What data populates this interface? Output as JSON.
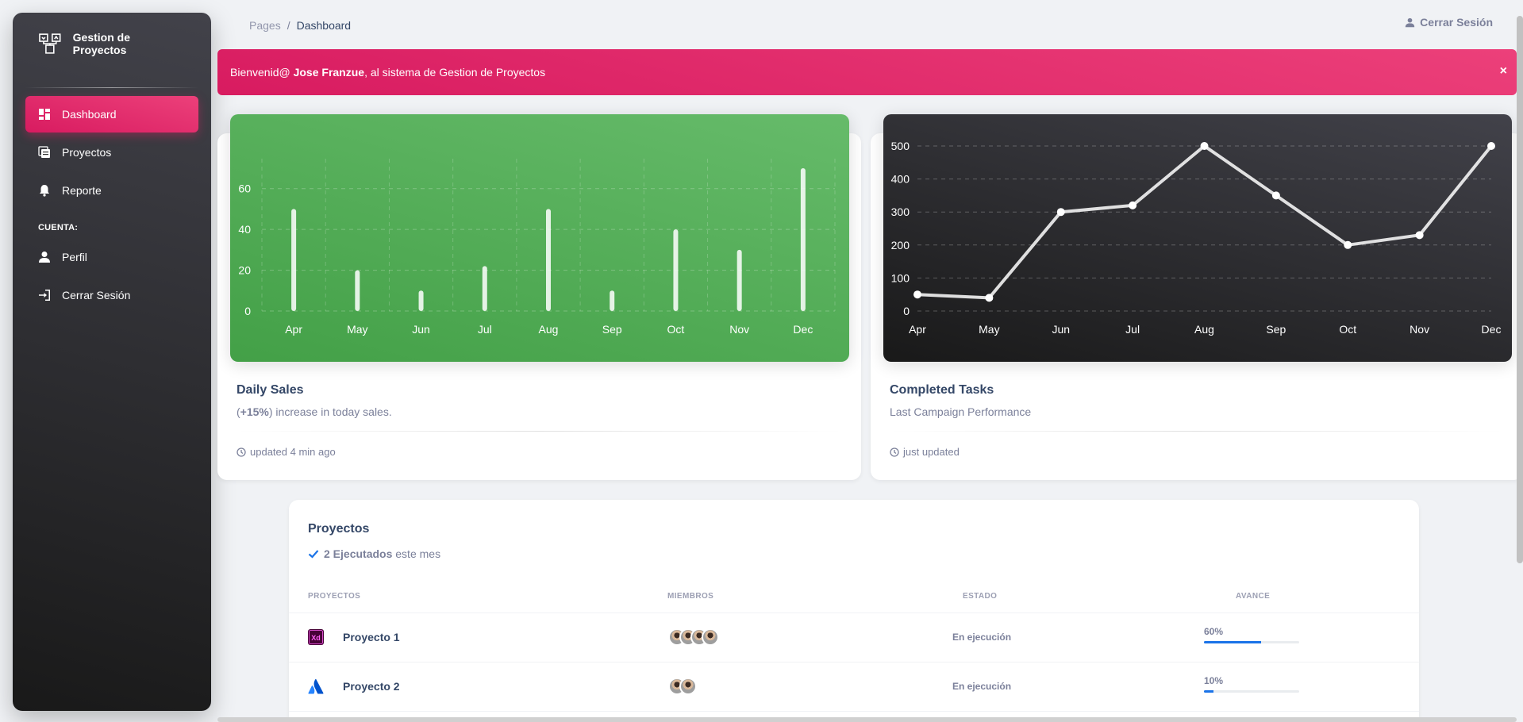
{
  "sidebar": {
    "brand": "Gestion de Proyectos",
    "items": [
      {
        "label": "Dashboard",
        "icon": "dashboard-icon"
      },
      {
        "label": "Proyectos",
        "icon": "table-icon"
      },
      {
        "label": "Reporte",
        "icon": "bell-icon"
      }
    ],
    "section_label": "CUENTA:",
    "account_items": [
      {
        "label": "Perfil",
        "icon": "person-icon"
      },
      {
        "label": "Cerrar Sesión",
        "icon": "login-icon"
      }
    ]
  },
  "navbar": {
    "breadcrumb_root": "Pages",
    "breadcrumb_sep": "/",
    "breadcrumb_current": "Dashboard",
    "logout_label": "Cerrar Sesión"
  },
  "alert": {
    "prefix": "Bienvenid@ ",
    "user": "Jose Franzue",
    "suffix": ", al sistema de Gestion de Proyectos",
    "close": "×"
  },
  "cards": {
    "sales": {
      "title": "Daily Sales",
      "sub_open": "(",
      "sub_bold": "+15%",
      "sub_rest": ") increase in today sales.",
      "footer": "updated 4 min ago"
    },
    "tasks": {
      "title": "Completed Tasks",
      "sub": "Last Campaign Performance",
      "footer": "just updated"
    }
  },
  "chart_data": [
    {
      "type": "bar",
      "categories": [
        "Apr",
        "May",
        "Jun",
        "Jul",
        "Aug",
        "Sep",
        "Oct",
        "Nov",
        "Dec"
      ],
      "values": [
        50,
        20,
        10,
        22,
        50,
        10,
        40,
        30,
        70
      ],
      "yticks": [
        0,
        20,
        40,
        60
      ],
      "ylim": [
        0,
        70
      ],
      "title": "",
      "xlabel": "",
      "ylabel": "",
      "grid": true
    },
    {
      "type": "line",
      "categories": [
        "Apr",
        "May",
        "Jun",
        "Jul",
        "Aug",
        "Sep",
        "Oct",
        "Nov",
        "Dec"
      ],
      "values": [
        50,
        40,
        300,
        320,
        500,
        350,
        200,
        230,
        500
      ],
      "yticks": [
        0,
        100,
        200,
        300,
        400,
        500
      ],
      "ylim": [
        0,
        500
      ],
      "title": "",
      "xlabel": "",
      "ylabel": "",
      "grid": true
    }
  ],
  "projects": {
    "title": "Proyectos",
    "executed_bold": "2 Ejecutados",
    "executed_rest": " este mes",
    "headers": [
      "PROYECTOS",
      "MIEMBROS",
      "ESTADO",
      "AVANCE"
    ],
    "rows": [
      {
        "name": "Proyecto 1",
        "logo": "adobe-xd-icon",
        "members": 4,
        "estado": "En ejecución",
        "avance": "60%",
        "progress": 0.6
      },
      {
        "name": "Proyecto 2",
        "logo": "atlassian-icon",
        "members": 2,
        "estado": "En ejecución",
        "avance": "10%",
        "progress": 0.1
      }
    ]
  },
  "colors": {
    "primary": "#e91e63",
    "success": "#4caf50",
    "dark": "#191919",
    "info": "#1a73e8"
  }
}
